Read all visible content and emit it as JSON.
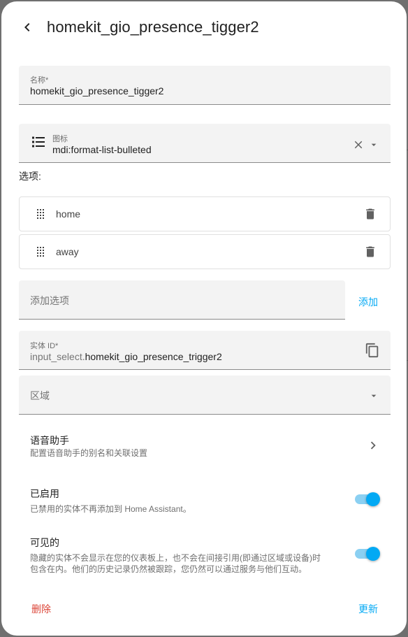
{
  "header": {
    "title": "homekit_gio_presence_tigger2",
    "back_icon": "chevron-left-icon"
  },
  "name_field": {
    "label": "名称*",
    "value": "homekit_gio_presence_tigger2"
  },
  "icon_field": {
    "label": "图标",
    "value": "mdi:format-list-bulleted",
    "icon": "format-list-bulleted-icon"
  },
  "options": {
    "label": "选项:",
    "items": [
      {
        "label": "home"
      },
      {
        "label": "away"
      }
    ]
  },
  "add_option": {
    "placeholder": "添加选项",
    "button_label": "添加"
  },
  "entity_id_field": {
    "label": "实体 ID*",
    "prefix": "input_select.",
    "value": "homekit_gio_presence_trigger2"
  },
  "area_field": {
    "label": "区域"
  },
  "voice_assistant": {
    "title": "语音助手",
    "subtitle": "配置语音助手的别名和关联设置"
  },
  "enabled": {
    "title": "已启用",
    "subtitle": "已禁用的实体不再添加到 Home Assistant。",
    "checked": true
  },
  "visible": {
    "title": "可见的",
    "subtitle_line1": "隐藏的实体不会显示在您的仪表板上，也不会在间接引用(即通过区域或设备)时",
    "subtitle_line2": "包含在内。他们的历史记录仍然被跟踪，您仍然可以通过服务与他们互动。",
    "checked": true
  },
  "actions": {
    "delete_label": "删除",
    "update_label": "更新"
  },
  "colors": {
    "accent": "#03a9f4",
    "danger": "#db4437",
    "field_bg": "#f3f3f3"
  }
}
